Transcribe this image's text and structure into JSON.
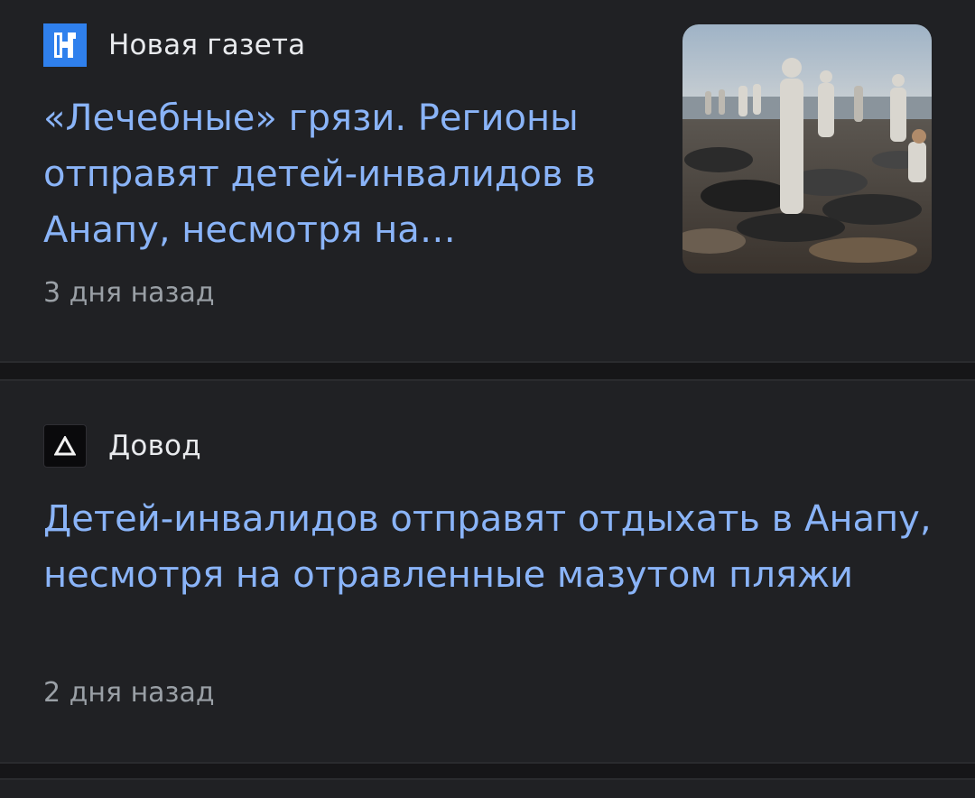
{
  "articles": [
    {
      "source": {
        "name": "Новая газета",
        "logo_icon": "novaya-gazeta-logo",
        "logo_color": "#2f80ed"
      },
      "headline": "«Лечебные» грязи. Регионы отправят детей-инвалидов в Анапу, несмотря на…",
      "time": "3 дня назад",
      "thumbnail": "beach-cleanup-photo"
    },
    {
      "source": {
        "name": "Довод",
        "logo_icon": "dovod-logo",
        "logo_color": "#0a0a0c"
      },
      "headline": "Детей-инвалидов отправят отдыхать в Анапу, несмотря на отравленные мазутом пляжи",
      "time": "2 дня назад"
    }
  ],
  "colors": {
    "background": "#202124",
    "headline": "#8ab4f8",
    "source_text": "#e8eaed",
    "time_text": "#9aa0a6"
  }
}
